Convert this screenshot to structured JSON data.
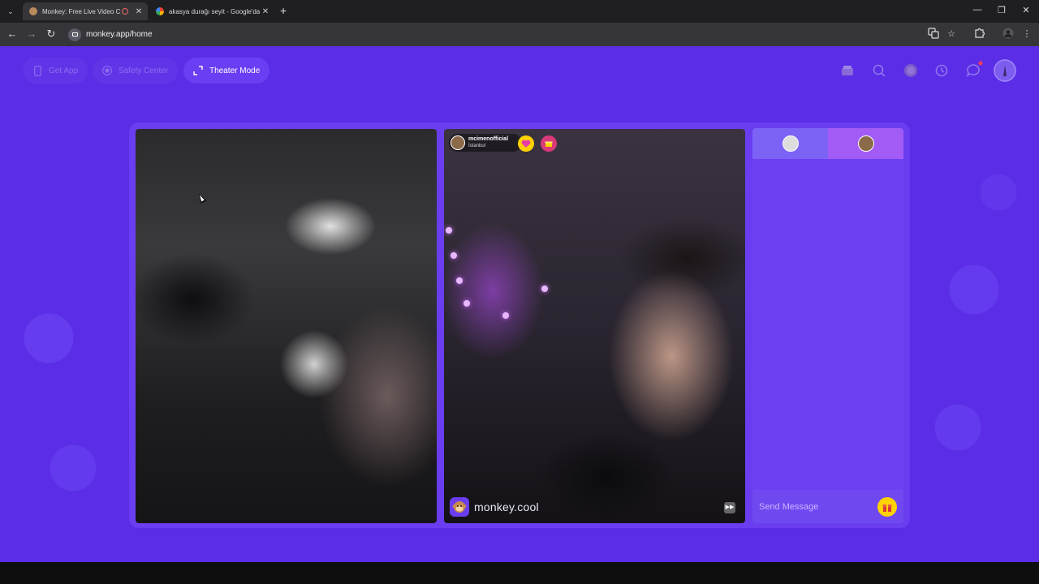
{
  "browser": {
    "tabs": [
      {
        "title": "Monkey: Free Live Video C",
        "active": true
      },
      {
        "title": "akasya durağı seyit - Google'da",
        "active": false
      }
    ],
    "url": "monkey.app/home"
  },
  "header": {
    "get_app": "Get App",
    "safety_center": "Safety Center",
    "theater_mode": "Theater Mode",
    "notification_dot_color": "#ff3b5c"
  },
  "partner": {
    "username": "mcimenofficial",
    "location": "İstanbul"
  },
  "watermark": "monkey.cool",
  "chat": {
    "placeholder": "Send Message"
  },
  "colors": {
    "background": "#5b2de6",
    "card": "#6a3ef0",
    "gift": "#ffd200"
  }
}
